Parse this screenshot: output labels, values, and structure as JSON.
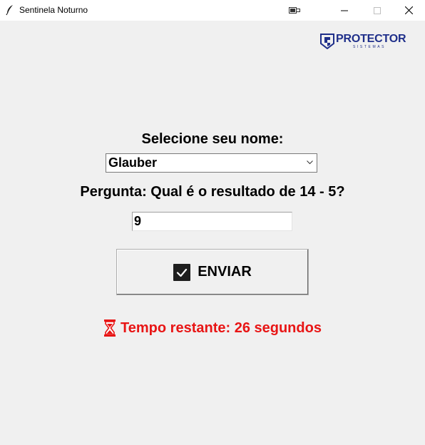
{
  "window": {
    "title": "Sentinela Noturno",
    "icons": [
      "feather-icon",
      "tablet-mode-icon",
      "minimize-icon",
      "maximize-icon",
      "close-icon"
    ]
  },
  "logo": {
    "brand": "PROTECTOR",
    "tagline": "SISTEMAS",
    "color": "#1f2f8a"
  },
  "form": {
    "select_label": "Selecione seu nome:",
    "selected_name": "Glauber",
    "question": "Pergunta: Qual é o resultado de 14 - 5?",
    "answer_value": "9",
    "submit_label": "ENVIAR",
    "submit_icon": "check-box-icon"
  },
  "timer": {
    "text": "Tempo restante: 26 segundos",
    "icon": "hourglass-icon",
    "color": "#e81515"
  }
}
